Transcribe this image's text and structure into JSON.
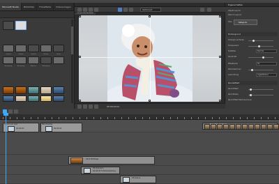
{
  "left_panel": {
    "tabs": [
      "Microsoft Studio",
      "Bibliothek",
      "Fotoeffekte",
      "Videovorlagen"
    ],
    "active_tab": 0,
    "captions": [
      "Schnitt",
      "Schnitt",
      "Schnitt",
      "Blende",
      "Zoom",
      "Bewegung",
      "Bewegung",
      "Rahmen",
      "Bewegung"
    ]
  },
  "preview": {
    "tab": "Vorschaufenster",
    "zoom_select": "Optimiert",
    "timecode": "00:00:00:01"
  },
  "properties": {
    "title": "Eigenschaften",
    "rows": {
      "r1": "Objekt-Layout",
      "r2": "Stile im Layout",
      "r3": "Titel"
    },
    "button": "Kategorie",
    "sections": {
      "s1": "Hintergrund",
      "s2": "Randeffekt"
    },
    "fields": {
      "f1": "Hintergrund-Farbe",
      "f2": "Transparenz",
      "f3": "Farbfilter",
      "f4": "Deckkraft",
      "f5": "Effektfarbe",
      "f6": "Weichzeichnen",
      "f7": "Ausrichtung",
      "f8": "Rand-Effekt",
      "f9": "Rand-Breite",
      "f10": "Rand-Effekt Weichzeichnen"
    },
    "values": {
      "v1": "Normal",
      "v2": "50",
      "v3": "Lagerbildner"
    }
  },
  "timeline": {
    "clips": {
      "c1": "Ich bin ein Lied",
      "c2": "Bild-Overlay",
      "c3": "00:00:04",
      "c4": "00:00:04",
      "c5": "2013 Bildfolge",
      "c6": "HD-Szenario",
      "c7": "00:00:05 Fotobearbeitung",
      "c8": "HD-Szene"
    },
    "top_clip": "Text, Bild, Zeitleiste"
  },
  "colors": {
    "accent": "#3fa9f5",
    "selection": "#4e7fc3"
  }
}
